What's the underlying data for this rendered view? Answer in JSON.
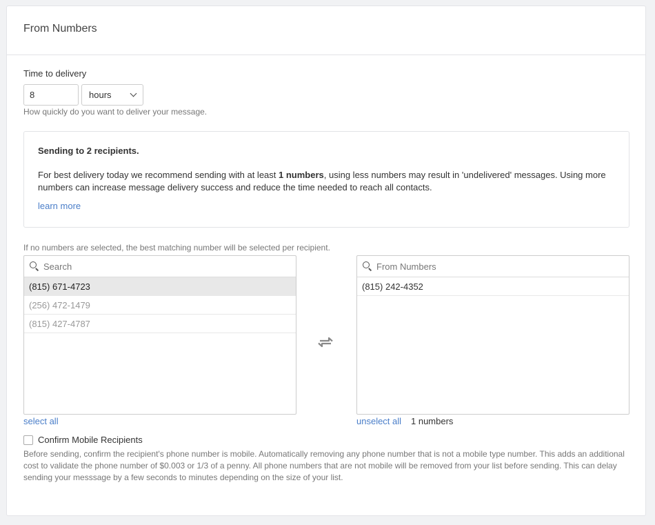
{
  "header": {
    "title": "From Numbers"
  },
  "delivery": {
    "label": "Time to delivery",
    "value": "8",
    "unit": "hours",
    "help": "How quickly do you want to deliver your message."
  },
  "info": {
    "title": "Sending to 2 recipients.",
    "text_before": "For best delivery today we recommend sending with at least ",
    "text_bold": "1 numbers",
    "text_after": ", using less numbers may result in 'undelivered' messages. Using more numbers can increase message delivery success and reduce the time needed to reach all contacts.",
    "learn_more": "learn more"
  },
  "note": "If no numbers are selected, the best matching number will be selected per recipient.",
  "available": {
    "search_placeholder": "Search",
    "items": [
      "(815) 671-4723",
      "(256) 472-1479",
      "(815) 427-4787"
    ],
    "select_all": "select all"
  },
  "selected": {
    "search_placeholder": "From Numbers",
    "items": [
      "(815) 242-4352"
    ],
    "unselect_all": "unselect all",
    "count": "1 numbers"
  },
  "confirm": {
    "label": "Confirm Mobile Recipients",
    "checked": false,
    "help": "Before sending, confirm the recipient's phone number is mobile. Automatically removing any phone number that is not a mobile type number. This adds an additional cost to validate the phone number of $0.003 or 1/3 of a penny. All phone numbers that are not mobile will be removed from your list before sending. This can delay sending your messsage by a few seconds to minutes depending on the size of your list."
  },
  "colors": {
    "link": "#4a7ec9",
    "selected_row": "#e8e8e8",
    "muted_text": "#999999"
  }
}
